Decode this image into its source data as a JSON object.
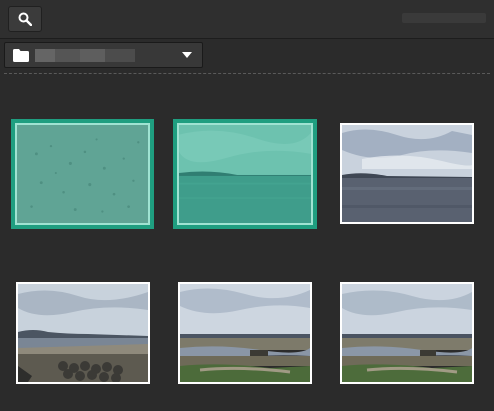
{
  "toolbar": {
    "search_icon": "search-icon"
  },
  "folder": {
    "label": "",
    "icon": "folder-icon",
    "dropdown_icon": "chevron-down-icon"
  },
  "colors": {
    "background": "#2b2b2b",
    "selection": "#1f9e80",
    "thumb_border": "#ffffff"
  },
  "thumbnails": [
    {
      "scene": "water-surface",
      "selected": true
    },
    {
      "scene": "sea-horizon",
      "selected": true
    },
    {
      "scene": "sea-horizon-cloudy",
      "selected": false
    },
    {
      "scene": "coastline-breakwater",
      "selected": false
    },
    {
      "scene": "riverbank-wide",
      "selected": false
    },
    {
      "scene": "riverbank-wide-2",
      "selected": false
    }
  ]
}
